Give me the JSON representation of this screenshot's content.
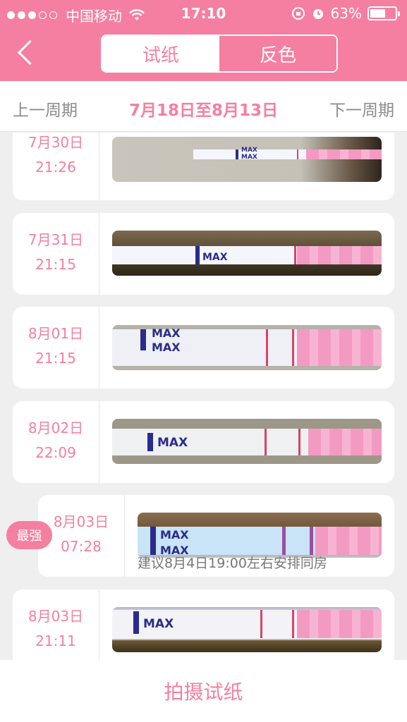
{
  "status_bar": {
    "carrier": "中国移动",
    "time": "17:10",
    "battery": "63%",
    "battery_level": 0.63
  },
  "header": {
    "tabs": [
      {
        "label": "试纸",
        "active": true
      },
      {
        "label": "反色",
        "active": false
      }
    ],
    "back_icon": "chevron-left-icon"
  },
  "week_nav": {
    "prev": "上一周期",
    "range": "7月18日至8月13日",
    "next": "下一周期"
  },
  "records": [
    {
      "date": "7月30日",
      "time": "21:26"
    },
    {
      "date": "7月31日",
      "time": "21:15"
    },
    {
      "date": "8月01日",
      "time": "21:15"
    },
    {
      "date": "8月02日",
      "time": "22:09"
    },
    {
      "date": "8月03日",
      "time": "07:28",
      "badge": "最强",
      "suggestion": "建议8月4日19:00左右安排同房"
    },
    {
      "date": "8月03日",
      "time": "21:11"
    }
  ],
  "strip_text": "MAX",
  "bottom_button": "拍摄试纸",
  "colors": {
    "accent": "#f57fa1",
    "background": "#efefef",
    "muted_text": "#8c8c8c"
  }
}
